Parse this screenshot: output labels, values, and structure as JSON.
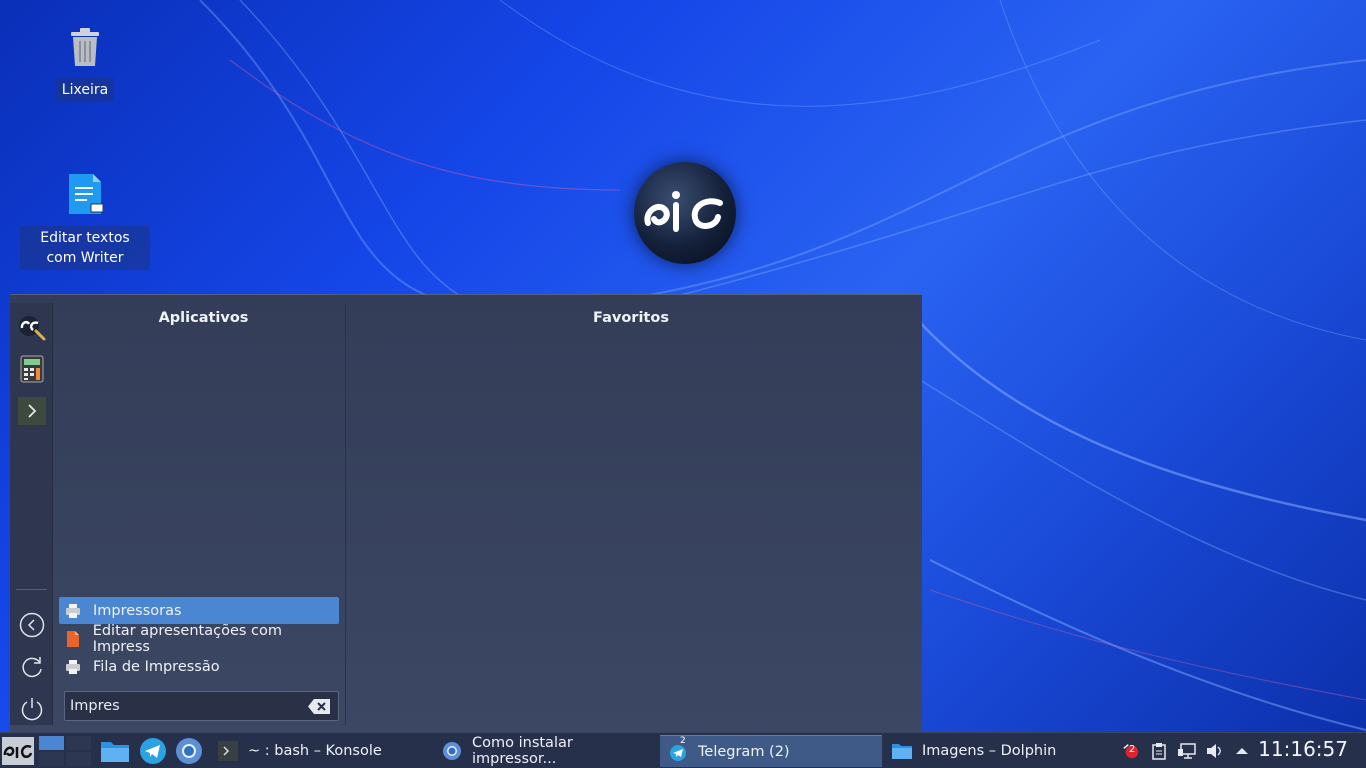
{
  "desktop": {
    "icons": [
      {
        "label": "Lixeira",
        "icon": "trash-icon"
      },
      {
        "label": "Editar textos com Writer",
        "icon": "writer-document-icon"
      }
    ]
  },
  "launcher": {
    "apps_title": "Aplicativos",
    "favorites_title": "Favoritos",
    "results": [
      {
        "label": "Impressoras",
        "icon": "printer-icon",
        "selected": true
      },
      {
        "label": "Editar apresentações com Impress",
        "icon": "impress-icon",
        "selected": false
      },
      {
        "label": "Fila de Impressão",
        "icon": "printer-icon",
        "selected": false
      }
    ],
    "search": {
      "value": "Impres"
    }
  },
  "taskbar": {
    "tasks": [
      {
        "label": "~ : bash – Konsole",
        "icon": "terminal-icon"
      },
      {
        "label": "Como instalar impressor...",
        "icon": "chromium-icon"
      },
      {
        "label": "Telegram (2)",
        "icon": "telegram-icon",
        "active": true,
        "badge": "2"
      },
      {
        "label": "Imagens – Dolphin",
        "icon": "folder-icon"
      }
    ],
    "tray_badge": "2",
    "clock": "11:16:57"
  },
  "colors": {
    "accent": "#4a86d2",
    "panel": "#343d58",
    "taskbar": "#27304a"
  }
}
